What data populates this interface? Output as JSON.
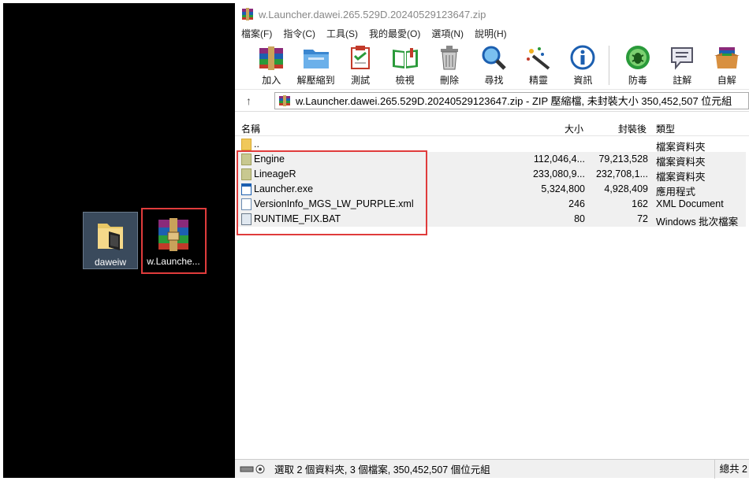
{
  "desktop": {
    "icons": [
      {
        "label": "daweiw",
        "icon": "folder-icon"
      },
      {
        "label": "w.Launche...",
        "icon": "winrar-archive-icon"
      }
    ]
  },
  "window": {
    "title": "w.Launcher.dawei.265.529D.20240529123647.zip",
    "menu": [
      "檔案(F)",
      "指令(C)",
      "工具(S)",
      "我的最愛(O)",
      "選項(N)",
      "說明(H)"
    ],
    "toolbar": [
      {
        "label": "加入",
        "icon": "add-archive-icon"
      },
      {
        "label": "解壓縮到",
        "icon": "extract-to-icon"
      },
      {
        "label": "測試",
        "icon": "test-icon"
      },
      {
        "label": "檢視",
        "icon": "view-book-icon"
      },
      {
        "label": "刪除",
        "icon": "trash-icon"
      },
      {
        "label": "尋找",
        "icon": "magnifier-icon"
      },
      {
        "label": "精靈",
        "icon": "wizard-wand-icon"
      },
      {
        "label": "資訊",
        "icon": "info-icon"
      },
      {
        "label": "防毒",
        "icon": "virus-scan-icon"
      },
      {
        "label": "註解",
        "icon": "comment-icon"
      },
      {
        "label": "自解",
        "icon": "sfx-icon"
      }
    ],
    "address": "w.Launcher.dawei.265.529D.20240529123647.zip - ZIP 壓縮檔, 未封裝大小 350,452,507 位元組",
    "columns": {
      "name": "名稱",
      "size": "大小",
      "packed": "封裝後",
      "type": "類型"
    },
    "rows": [
      {
        "name": "..",
        "size": "",
        "packed": "",
        "type": "檔案資料夾",
        "icon": "parent-folder-icon"
      },
      {
        "name": "Engine",
        "size": "112,046,4...",
        "packed": "79,213,528",
        "type": "檔案資料夾",
        "icon": "folder-icon"
      },
      {
        "name": "LineageR",
        "size": "233,080,9...",
        "packed": "232,708,1...",
        "type": "檔案資料夾",
        "icon": "folder-icon"
      },
      {
        "name": "Launcher.exe",
        "size": "5,324,800",
        "packed": "4,928,409",
        "type": "應用程式",
        "icon": "exe-icon"
      },
      {
        "name": "VersionInfo_MGS_LW_PURPLE.xml",
        "size": "246",
        "packed": "162",
        "type": "XML Document",
        "icon": "document-icon"
      },
      {
        "name": "RUNTIME_FIX.BAT",
        "size": "80",
        "packed": "72",
        "type": "Windows 批次檔案",
        "icon": "batch-file-icon"
      }
    ],
    "status": "選取 2 個資料夾, 3 個檔案, 350,452,507 個位元組",
    "status_right": "總共 2"
  }
}
